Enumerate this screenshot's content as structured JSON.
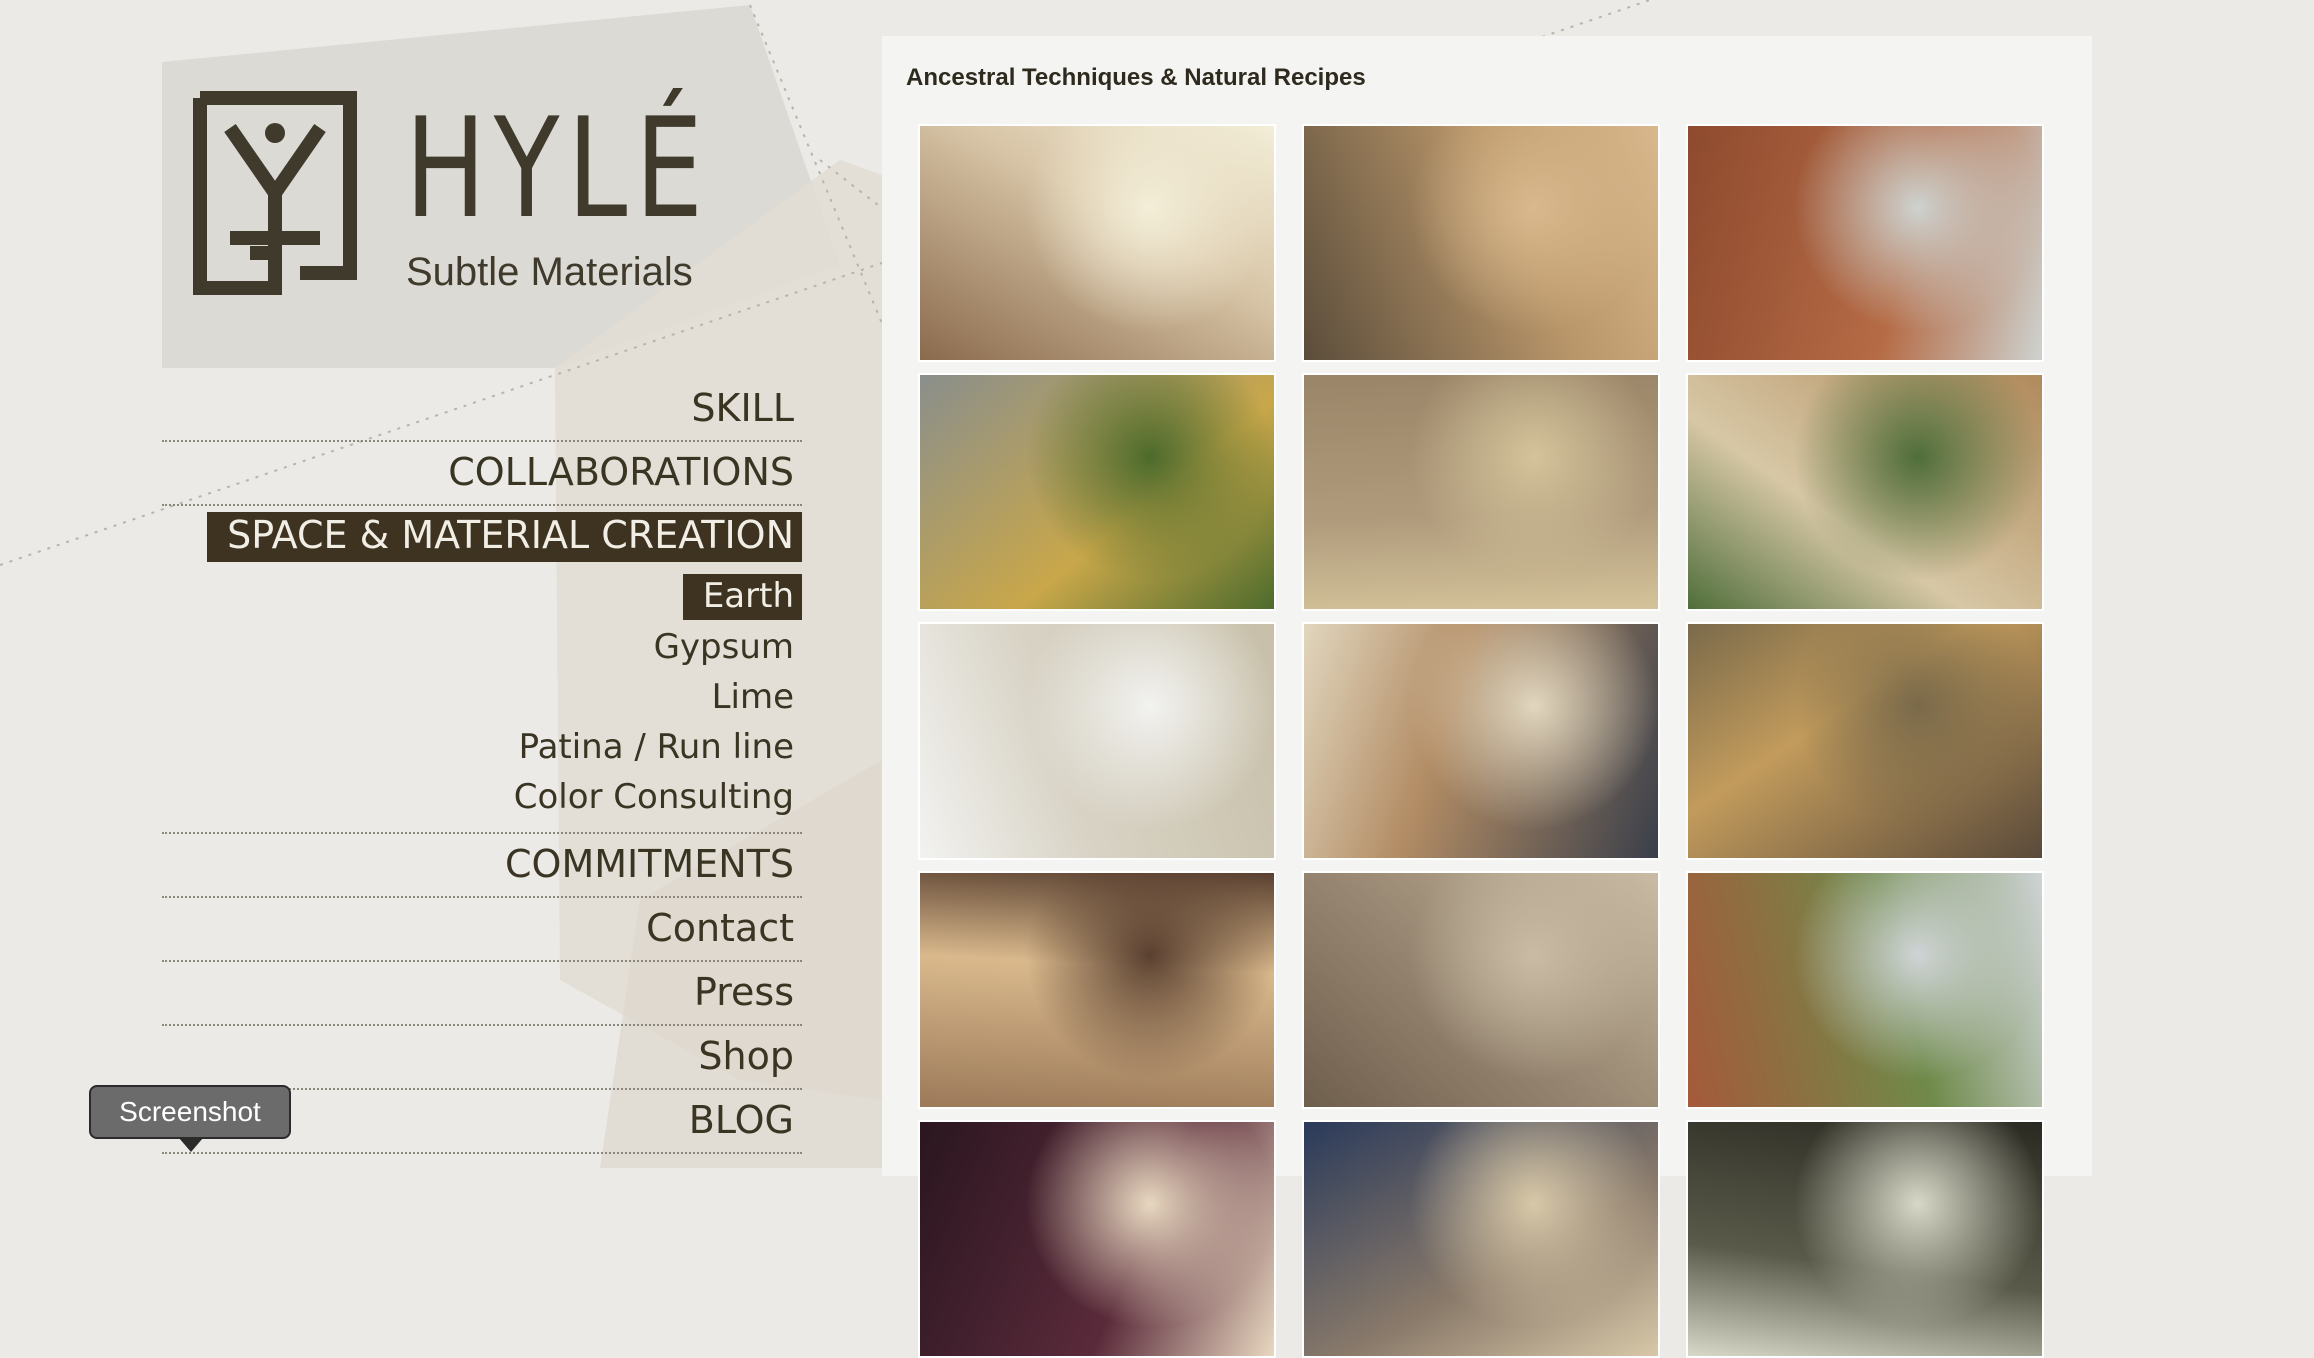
{
  "brand": {
    "logo_title": "HYLÉ",
    "logo_subtitle": "Subtle Materials"
  },
  "nav": {
    "items": [
      {
        "label": "SKILL",
        "active": false
      },
      {
        "label": "COLLABORATIONS",
        "active": false
      },
      {
        "label": "SPACE & MATERIAL CREATION",
        "active": true
      }
    ],
    "sub_items": [
      {
        "label": "Earth",
        "active": true
      },
      {
        "label": "Gypsum",
        "active": false
      },
      {
        "label": "Lime",
        "active": false
      },
      {
        "label": "Patina / Run line",
        "active": false
      },
      {
        "label": "Color Consulting",
        "active": false
      }
    ],
    "items_after": [
      {
        "label": "COMMITMENTS"
      },
      {
        "label": "Contact"
      },
      {
        "label": "Press"
      },
      {
        "label": "Shop"
      },
      {
        "label": "BLOG"
      }
    ]
  },
  "tooltip": {
    "label": "Screenshot"
  },
  "gallery": {
    "title": "Ancestral Techniques & Natural Recipes",
    "thumbnails": [
      {
        "icon": "hand-on-wall-photo",
        "colors": [
          "#8b6a4c",
          "#d9c6a8",
          "#f3eed8"
        ]
      },
      {
        "icon": "sifting-earth-photo",
        "colors": [
          "#5b4d3b",
          "#b9966a",
          "#d8b88c"
        ]
      },
      {
        "icon": "carved-ornament-photo",
        "colors": [
          "#8e4a2e",
          "#b56b45",
          "#cdd2cf"
        ]
      },
      {
        "icon": "countryside-house-photo",
        "colors": [
          "#8a8f8c",
          "#c9a74a",
          "#4d6b2c"
        ]
      },
      {
        "icon": "straw-earth-texture-photo",
        "colors": [
          "#9a8568",
          "#b09b7c",
          "#d4c39a"
        ]
      },
      {
        "icon": "earth-wall-path-photo",
        "colors": [
          "#b08a5c",
          "#d7c7a5",
          "#4f6e3a"
        ]
      },
      {
        "icon": "switch-on-wall-photo",
        "colors": [
          "#c7bfa8",
          "#d8d3c5",
          "#f2f2f0"
        ]
      },
      {
        "icon": "painting-sketch-photo",
        "colors": [
          "#3a3f4a",
          "#b28c64",
          "#e1d6be"
        ]
      },
      {
        "icon": "straw-bale-wall-photo",
        "colors": [
          "#5a4a3a",
          "#c29b5c",
          "#7a6a4a"
        ]
      },
      {
        "icon": "wooden-corridor-photo",
        "colors": [
          "#9c7a5a",
          "#d9b98c",
          "#5a4030"
        ]
      },
      {
        "icon": "wood-shingles-photo",
        "colors": [
          "#6e5e4c",
          "#a2927c",
          "#c9bba4"
        ]
      },
      {
        "icon": "brick-building-photo",
        "colors": [
          "#a55a3a",
          "#6f8a4a",
          "#cfd4d6"
        ]
      },
      {
        "icon": "light-bulb-room-photo",
        "colors": [
          "#2a1620",
          "#5a2a3a",
          "#e8d8c0"
        ]
      },
      {
        "icon": "window-interior-photo",
        "colors": [
          "#2a3a5a",
          "#8a7a6a",
          "#d8c8a8"
        ]
      },
      {
        "icon": "dark-interior-photo",
        "colors": [
          "#2a2a22",
          "#5a5a4a",
          "#d8d8c8"
        ]
      }
    ]
  }
}
